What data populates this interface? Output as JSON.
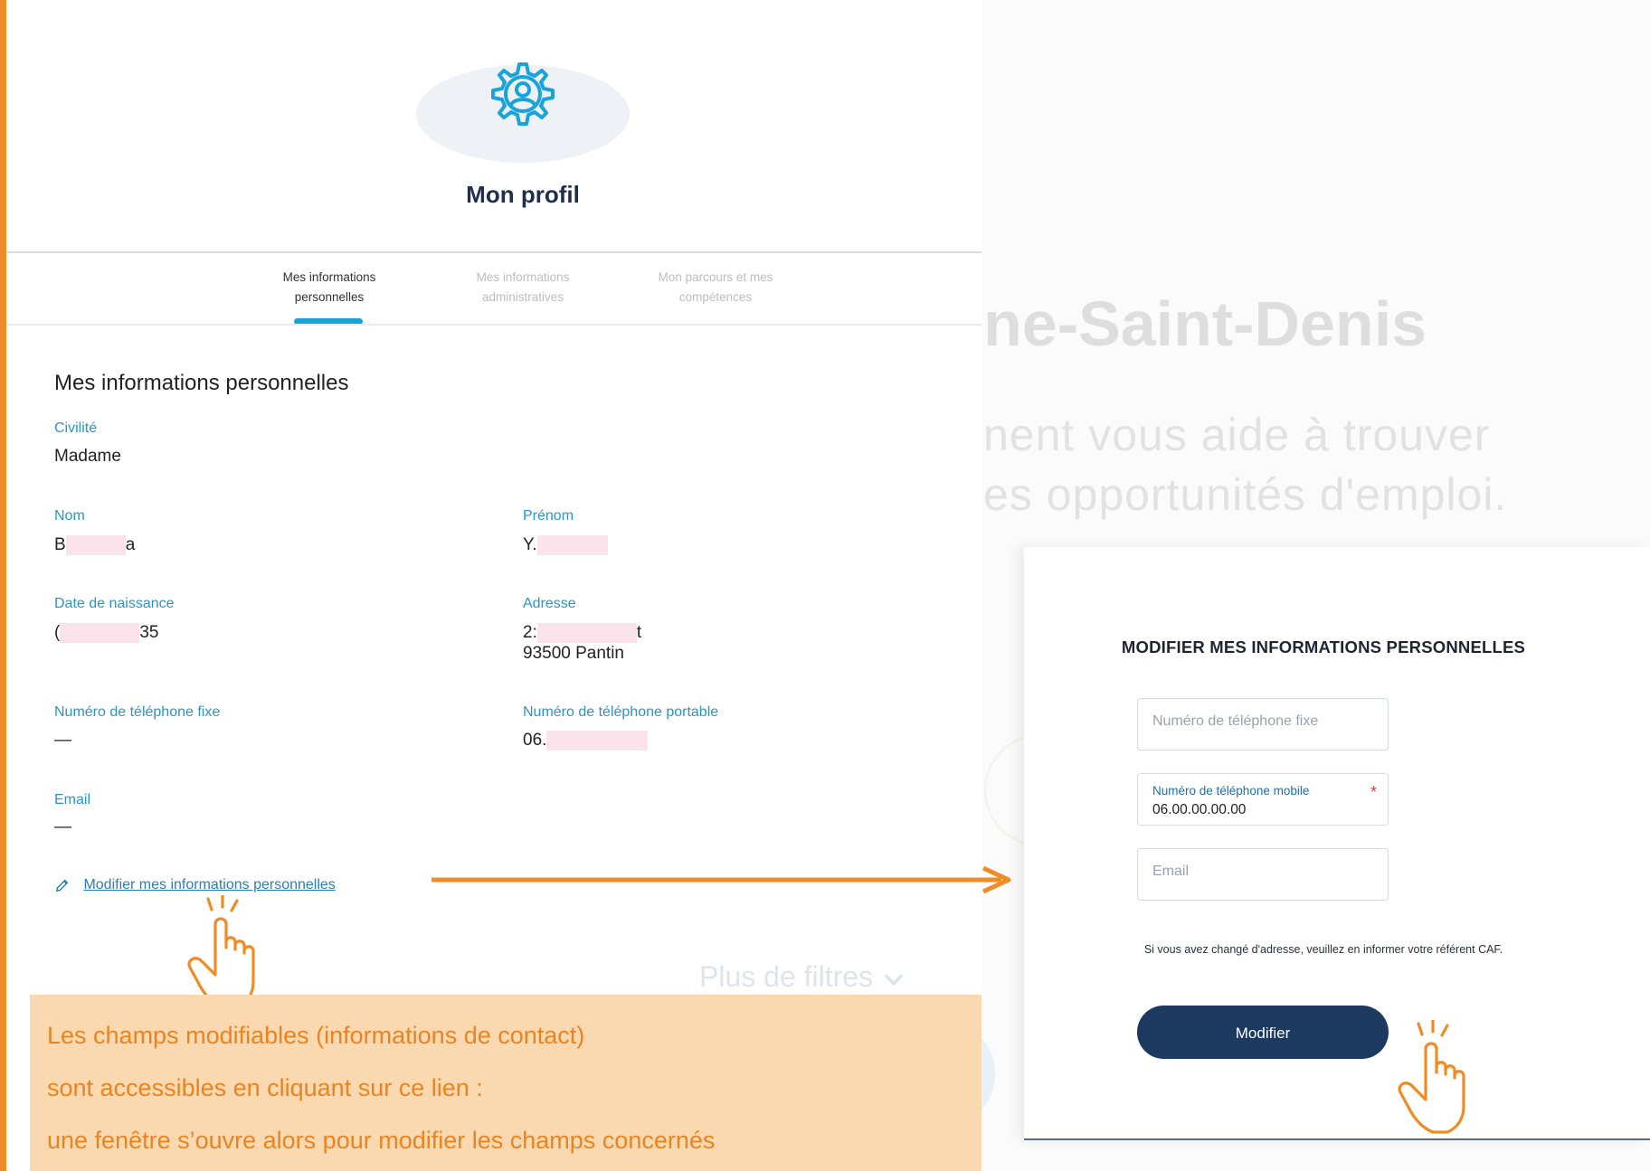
{
  "profile": {
    "title": "Mon profil",
    "tabs": [
      {
        "label_line1": "Mes informations",
        "label_line2": "personnelles",
        "active": true
      },
      {
        "label_line1": "Mes informations",
        "label_line2": "administratives",
        "active": false
      },
      {
        "label_line1": "Mon parcours et mes",
        "label_line2": "compétences",
        "active": false
      }
    ],
    "section_title": "Mes informations personnelles",
    "fields": {
      "civilite": {
        "label": "Civilité",
        "value": "Madame"
      },
      "nom": {
        "label": "Nom",
        "value_prefix": "B",
        "value_suffix": "a"
      },
      "prenom": {
        "label": "Prénom",
        "value_prefix": "Y."
      },
      "date_naissance": {
        "label": "Date de naissance",
        "value_prefix": "(",
        "value_suffix": "35"
      },
      "adresse": {
        "label": "Adresse",
        "line1_prefix": "2:",
        "line1_suffix": "t",
        "line2": "93500 Pantin"
      },
      "tel_fixe": {
        "label": "Numéro de téléphone fixe",
        "value": "—"
      },
      "tel_portable": {
        "label": "Numéro de téléphone portable",
        "value_prefix": "06."
      },
      "email": {
        "label": "Email",
        "value": "—"
      }
    },
    "edit_link": "Modifier mes informations personnelles"
  },
  "callout": {
    "line1": "Les champs modifiables (informations de contact)",
    "line2": "sont accessibles en cliquant sur ce lien :",
    "line3": "une fenêtre s’ouvre alors pour modifier les champs concernés"
  },
  "background_page": {
    "title_fragment": "ne-Saint-Denis",
    "line1_fragment": "nent vous aide à trouver",
    "line2_fragment": "es opportunités d'emploi.",
    "filters_label": "Plus de filtres"
  },
  "modal": {
    "title": "MODIFIER MES INFORMATIONS PERSONNELLES",
    "fields": {
      "tel_fixe": {
        "placeholder": "Numéro de téléphone fixe"
      },
      "tel_mobile": {
        "label": "Numéro de téléphone mobile",
        "value": "06.00.00.00.00",
        "required_mark": "*"
      },
      "email": {
        "placeholder": "Email"
      }
    },
    "note": "Si vous avez changé d'adresse, veuillez en informer votre référent CAF.",
    "submit_label": "Modifier"
  },
  "colors": {
    "accent_orange": "#ef8c25",
    "callout_bg": "#fbd9b0",
    "callout_text": "#e98422",
    "label_blue": "#2a95c6",
    "tab_indicator": "#1aa3d9",
    "button_navy": "#1c3a5f"
  },
  "icons": {
    "profile": "gear-user-icon",
    "edit": "pencil-icon",
    "pointer": "hand-pointer-icon",
    "arrow": "arrow-right-icon",
    "filters": "chevron-down-icon"
  }
}
